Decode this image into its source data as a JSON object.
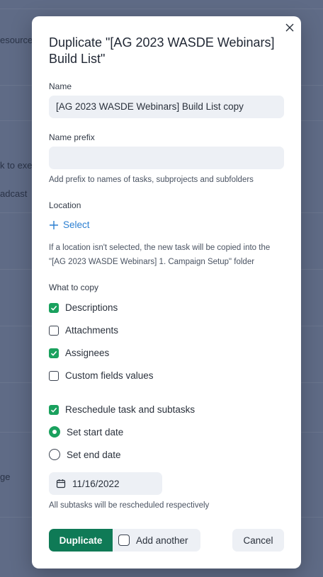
{
  "background": {
    "texts": [
      "esources",
      "k to exe",
      "adcast",
      "ge"
    ]
  },
  "dialog": {
    "title": "Duplicate \"[AG 2023 WASDE Webinars] Build List\"",
    "name": {
      "label": "Name",
      "value": "[AG 2023 WASDE Webinars] Build List copy"
    },
    "name_prefix": {
      "label": "Name prefix",
      "value": "",
      "hint": "Add prefix to names of tasks, subprojects and subfolders"
    },
    "location": {
      "label": "Location",
      "select_label": "Select",
      "hint_line1": "If a location isn't selected, the new task will be copied into the",
      "hint_line2": "\"[AG 2023 WASDE Webinars] 1. Campaign Setup\" folder"
    },
    "what_to_copy": {
      "label": "What to copy",
      "options": [
        {
          "label": "Descriptions",
          "checked": true
        },
        {
          "label": "Attachments",
          "checked": false
        },
        {
          "label": "Assignees",
          "checked": true
        },
        {
          "label": "Custom fields values",
          "checked": false
        }
      ]
    },
    "reschedule": {
      "label": "Reschedule task and subtasks",
      "checked": true,
      "start_label": "Set start date",
      "end_label": "Set end date",
      "selected": "start",
      "date": "11/16/2022",
      "hint": "All subtasks will be rescheduled respectively"
    },
    "footer": {
      "duplicate_label": "Duplicate",
      "add_another_label": "Add another",
      "add_another_checked": false,
      "cancel_label": "Cancel"
    }
  },
  "colors": {
    "accent": "#1aa15e",
    "primary_button": "#0f7a56",
    "link": "#2b7fd1",
    "overlay": "#5f6b86"
  }
}
